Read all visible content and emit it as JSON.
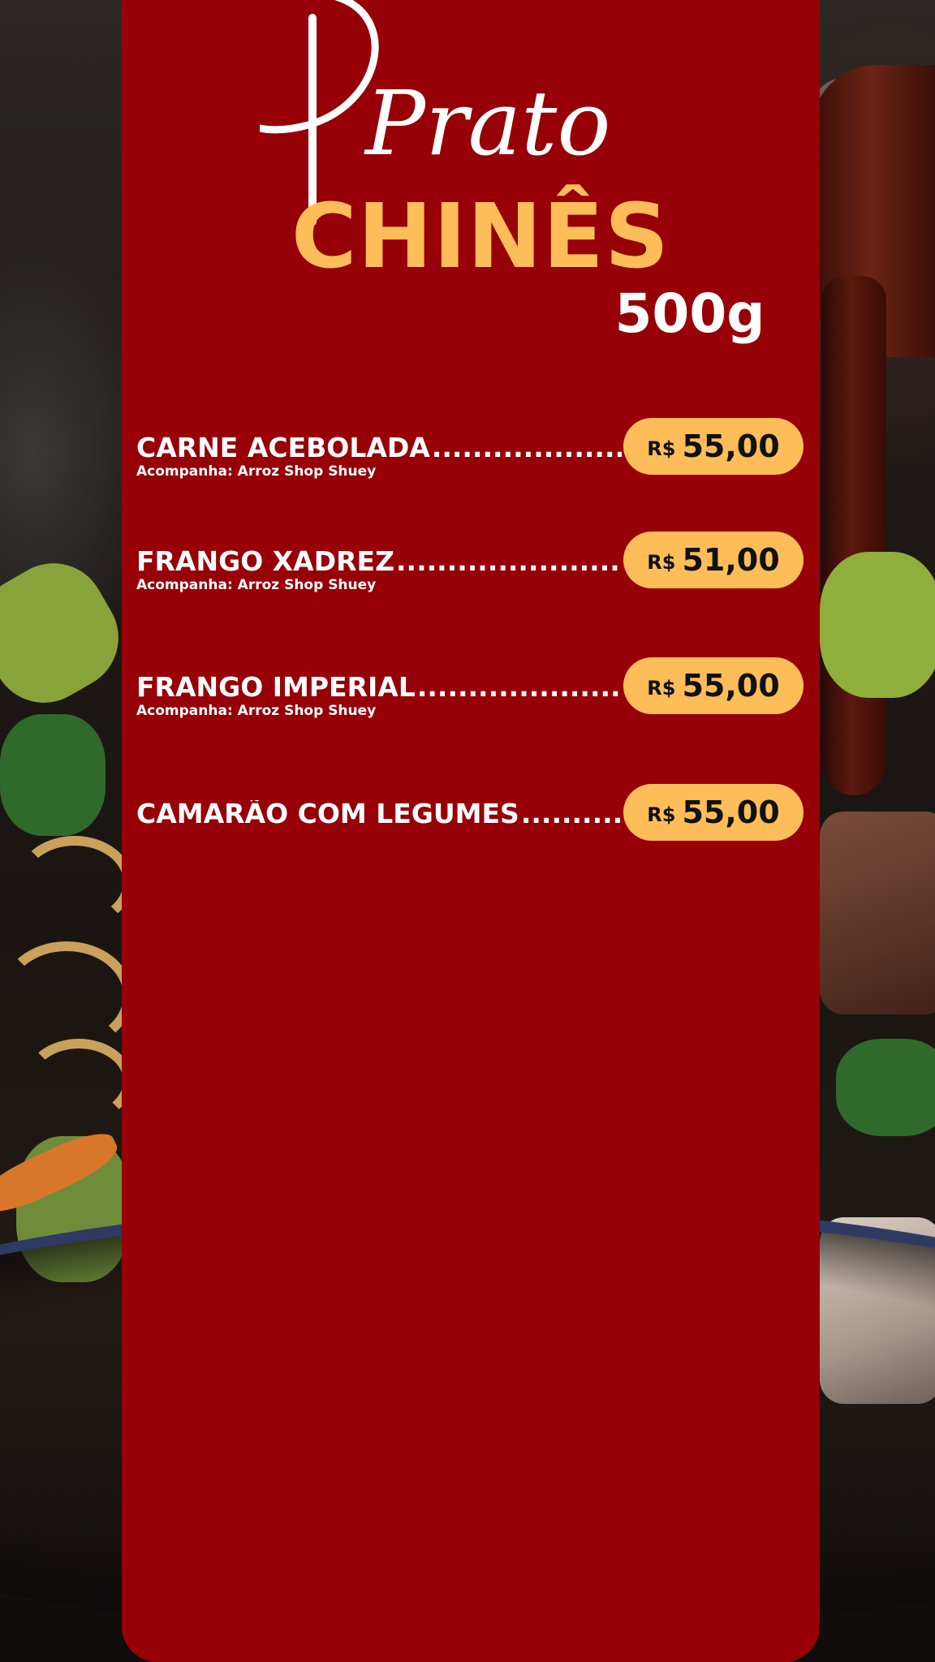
{
  "title": {
    "script": "Prato",
    "main": "CHINÊS",
    "weight": "500g"
  },
  "colors": {
    "panel": "#960006",
    "accent": "#ffbd59",
    "text": "#ffffff",
    "price_text": "#111111"
  },
  "items": [
    {
      "name": "CARNE ACEBOLADA",
      "dots": "....................",
      "side": "Acompanha: Arroz Shop Shuey",
      "currency": "R$",
      "price": "55,00"
    },
    {
      "name": "FRANGO XADREZ",
      "dots": "............................",
      "side": "Acompanha: Arroz Shop Shuey",
      "currency": "R$",
      "price": "51,00"
    },
    {
      "name": "FRANGO IMPERIAL",
      "dots": "........................",
      "side": "Acompanha: Arroz Shop Shuey",
      "currency": "R$",
      "price": "55,00"
    },
    {
      "name": "CAMARÃO COM LEGUMES",
      "dots": "..........",
      "currency": "R$",
      "price": "55,00"
    }
  ]
}
